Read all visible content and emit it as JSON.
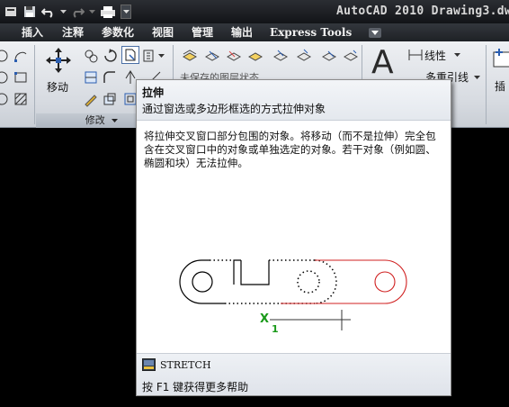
{
  "window": {
    "title": "AutoCAD 2010  Drawing3.dw"
  },
  "quick_access": [
    "app-menu-icon",
    "save-icon",
    "undo-icon",
    "redo-icon",
    "plot-icon",
    "dropdown-icon"
  ],
  "menu": {
    "items": [
      "插入",
      "注释",
      "参数化",
      "视图",
      "管理",
      "输出",
      "Express Tools"
    ]
  },
  "ribbon": {
    "modify_panel": {
      "label": "修改",
      "move_label": "移动"
    },
    "layers_panel": {
      "layer_state": "未保存的图层状态"
    },
    "annotation_panel": {
      "big_text": "A",
      "linear_label": "线性",
      "multileader_label": "多重引线"
    },
    "insert_panel": {
      "label": "插"
    }
  },
  "tooltip": {
    "title": "拉伸",
    "subtitle": "通过窗选或多边形框选的方式拉伸对象",
    "description": "将拉伸交叉窗口部分包围的对象。将移动（而不是拉伸）完全包含在交叉窗口中的对象或单独选定的对象。若干对象（例如圆、椭圆和块）无法拉伸。",
    "command": "STRETCH",
    "help": "按 F1 键获得更多帮助",
    "illustration": {
      "axis_x": "X",
      "axis_sub": "1"
    }
  },
  "colors": {
    "accent_red": "#d02020",
    "axis_green": "#1a9a1a",
    "canvas": "#000000"
  }
}
